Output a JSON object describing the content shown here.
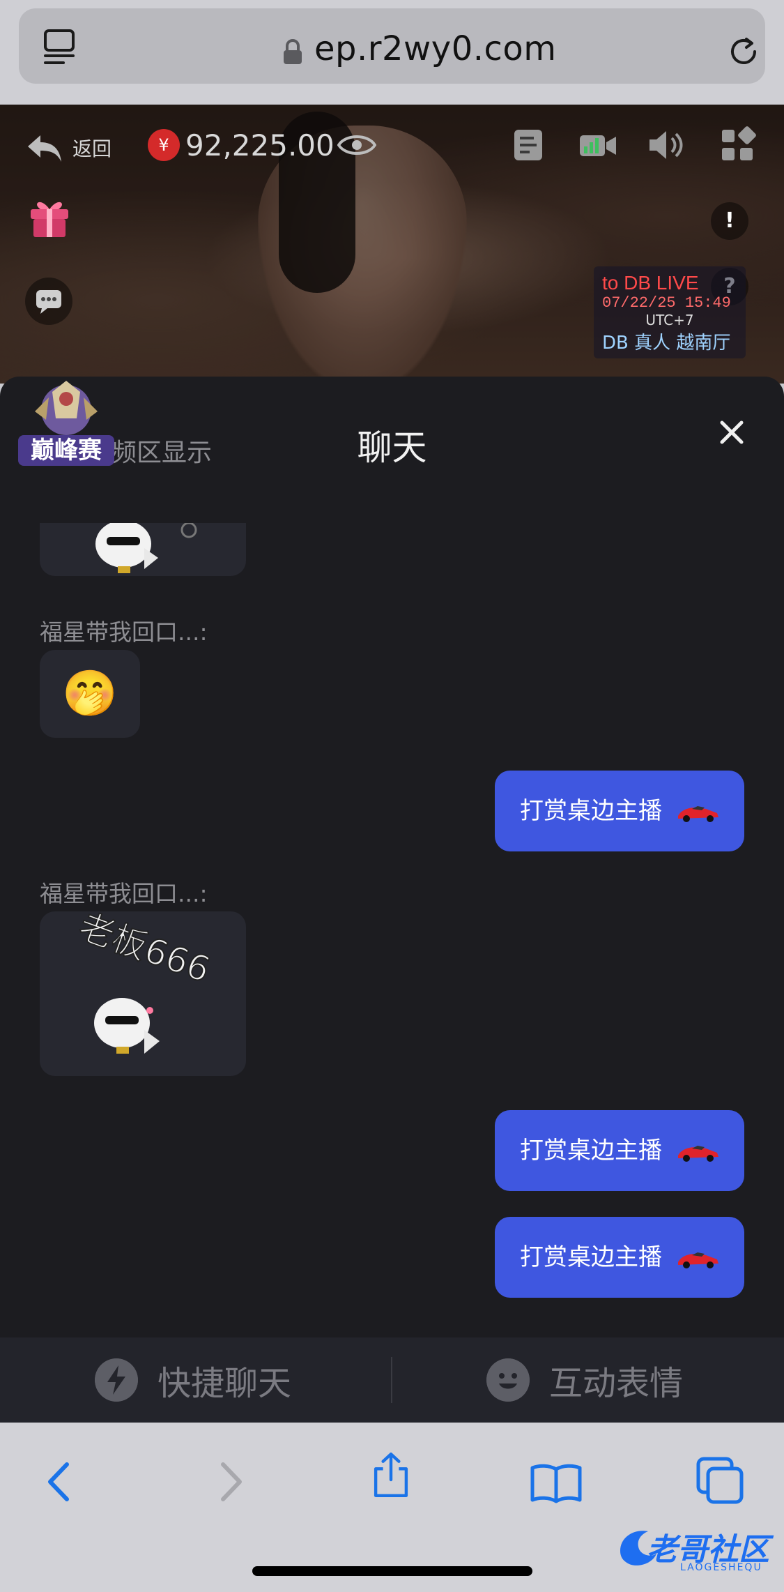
{
  "browser": {
    "url": "ep.r2wy0.com"
  },
  "video": {
    "back_label": "返回",
    "currency_symbol": "¥",
    "balance": "92,225.00",
    "stamp": {
      "line1": "to DB LIVE",
      "line2": "07/22/25  15:49",
      "line3": "UTC+7",
      "line4": "DB 真人 越南厅"
    },
    "info_glyph": "!",
    "help_glyph": "?"
  },
  "chat": {
    "title": "聊天",
    "hint": "频区显示",
    "badge_text": "巅峰赛",
    "messages": [
      {
        "type": "sticker",
        "sender": ""
      },
      {
        "type": "emoji",
        "sender": "福星带我回口...:",
        "emoji": "🤭"
      },
      {
        "type": "mine",
        "text": "打赏桌边主播"
      },
      {
        "type": "sticker",
        "sender": "福星带我回口...:",
        "caption": "老板666"
      },
      {
        "type": "mine",
        "text": "打赏桌边主播"
      },
      {
        "type": "mine",
        "text": "打赏桌边主播"
      }
    ],
    "actions": {
      "quick_chat": "快捷聊天",
      "emotes": "互动表情"
    }
  },
  "watermark": {
    "text": "老哥社区",
    "sub": "LAOGESHEQU"
  },
  "colors": {
    "accent": "#3f57e0",
    "sheet_bg": "#1c1c20",
    "safari_blue": "#1a73e8"
  }
}
